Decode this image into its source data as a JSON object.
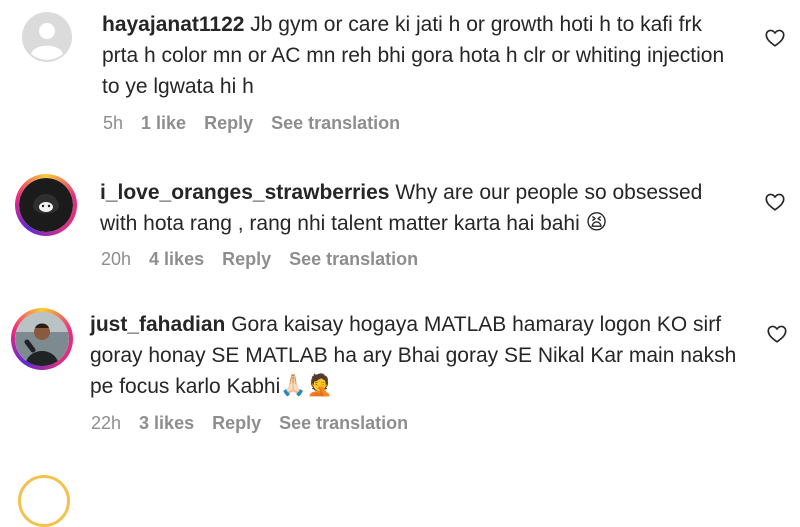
{
  "comments": [
    {
      "username": "hayajanat1122",
      "text": "Jb gym or care ki jati h or growth hoti h to kafi frk prta h color mn or AC mn reh bhi gora hota h clr or whiting injection to ye lgwata hi h",
      "time": "5h",
      "likes": "1 like",
      "reply": "Reply",
      "translate": "See translation"
    },
    {
      "username": "i_love_oranges_strawberries",
      "text": "Why are our people so obsessed with hota rang , rang nhi talent matter karta hai bahi",
      "emoji": "😫",
      "time": "20h",
      "likes": "4 likes",
      "reply": "Reply",
      "translate": "See translation"
    },
    {
      "username": "just_fahadian",
      "text": "Gora kaisay hogaya MATLAB hamaray logon KO sirf goray honay SE MATLAB ha ary Bhai goray SE Nikal Kar main naksh pe focus karlo Kabhi",
      "emoji": "🙏🏻🤦",
      "time": "22h",
      "likes": "3 likes",
      "reply": "Reply",
      "translate": "See translation"
    }
  ],
  "icons": {
    "heart": "heart-outline-icon",
    "avatar_default": "default-avatar-icon"
  },
  "colors": {
    "text": "#262626",
    "meta": "#8e8e8e",
    "story_ring": "#ee2a7b"
  }
}
